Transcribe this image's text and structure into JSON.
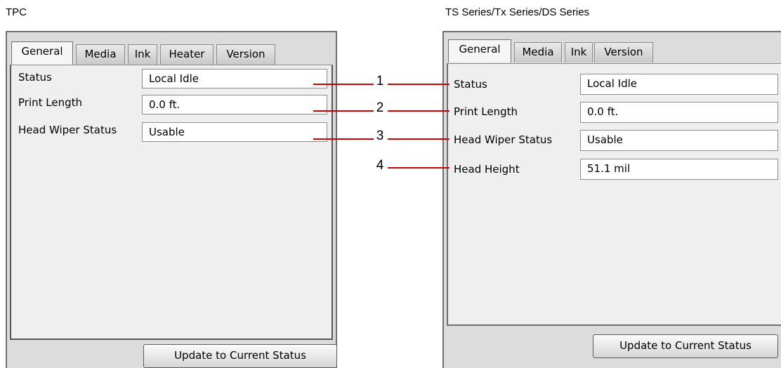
{
  "captions": {
    "tpc": "TPC",
    "ts": "TS Series/Tx Series/DS Series"
  },
  "tpc_window": {
    "tabs": [
      "General",
      "Media",
      "Ink",
      "Heater",
      "Version"
    ],
    "rows": [
      {
        "label": "Status",
        "value": "Local Idle"
      },
      {
        "label": "Print Length",
        "value": "0.0 ft."
      },
      {
        "label": "Head Wiper Status",
        "value": "Usable"
      }
    ],
    "update_button": "Update to Current Status"
  },
  "ts_window": {
    "tabs": [
      "General",
      "Media",
      "Ink",
      "Version"
    ],
    "rows": [
      {
        "label": "Status",
        "value": "Local Idle"
      },
      {
        "label": "Print Length",
        "value": "0.0 ft."
      },
      {
        "label": "Head Wiper Status",
        "value": "Usable"
      },
      {
        "label": "Head Height",
        "value": "51.1 mil"
      }
    ],
    "update_button": "Update to Current Status"
  },
  "callouts": [
    "1",
    "2",
    "3",
    "4"
  ],
  "colors": {
    "callout_line": "#d00000"
  }
}
